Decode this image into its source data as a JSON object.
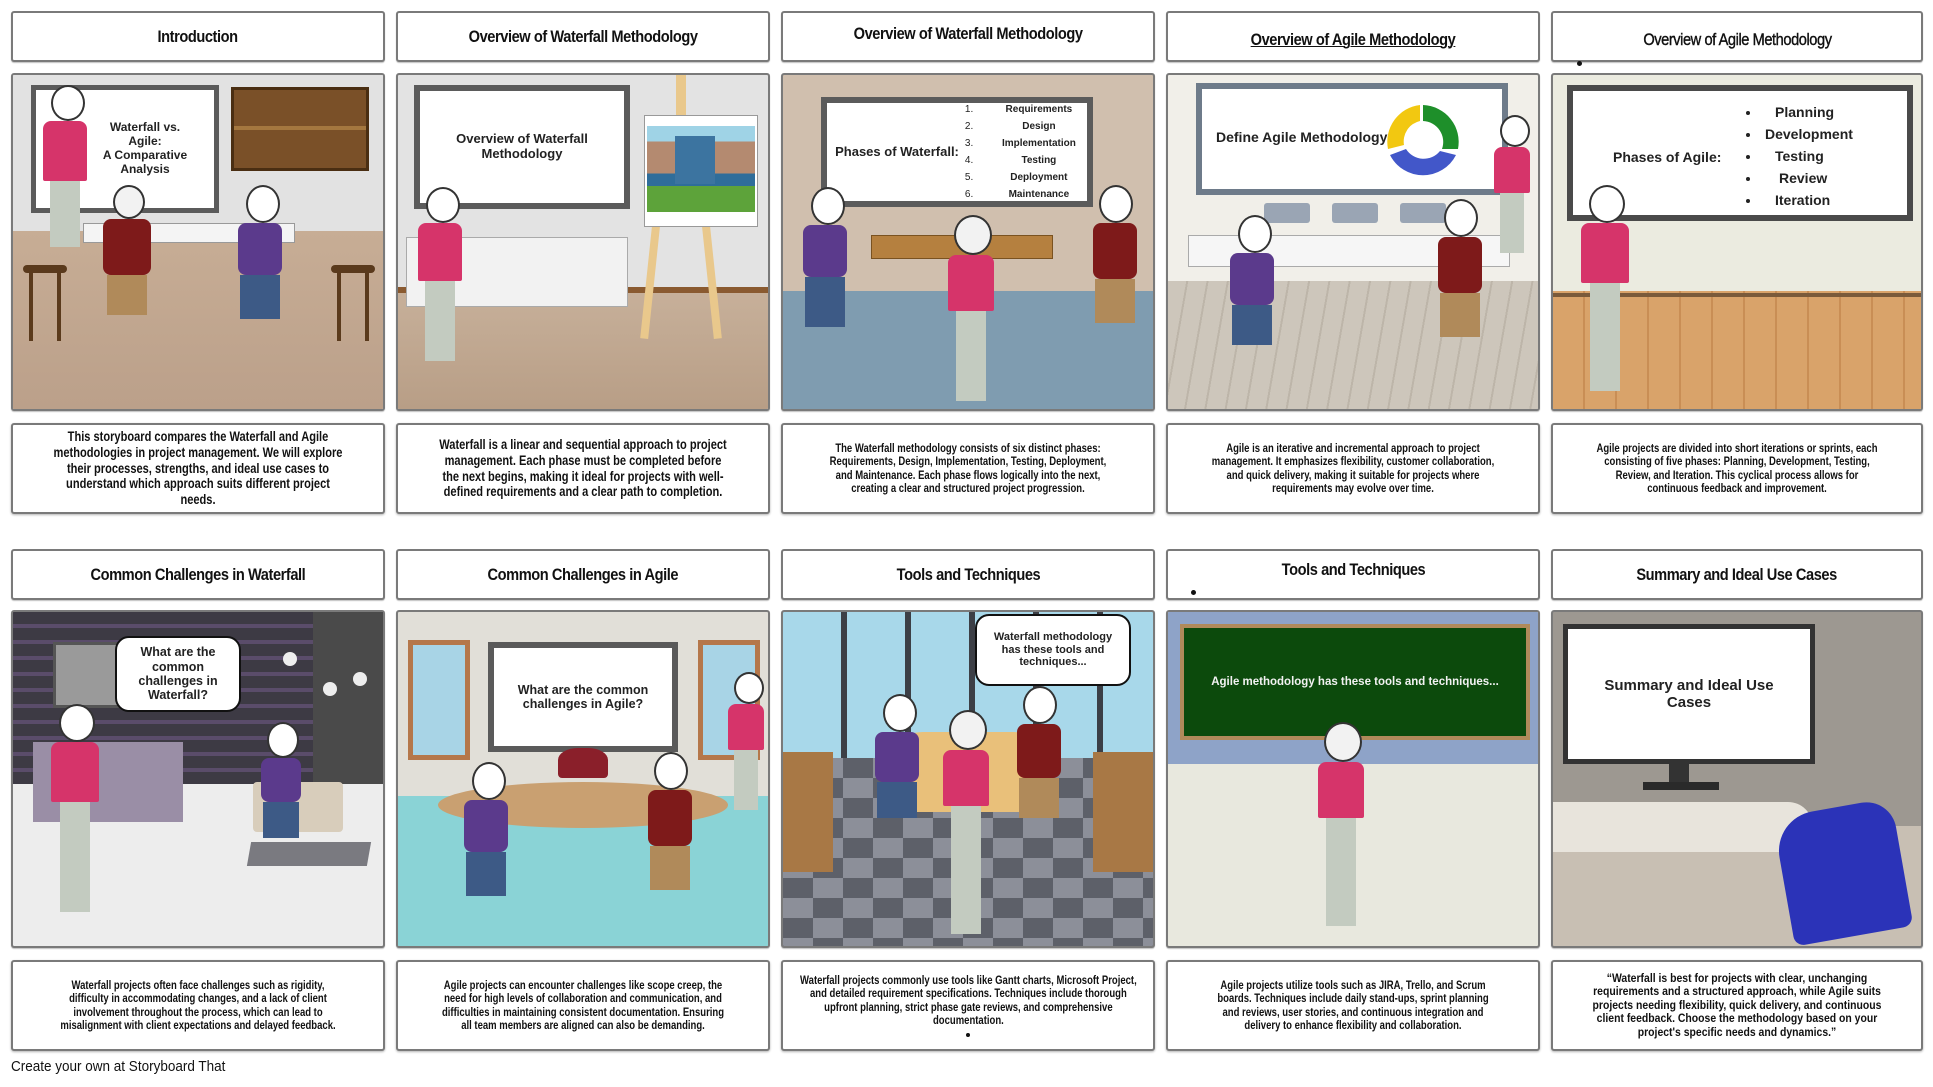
{
  "storyboard": {
    "row1": [
      {
        "title": "Introduction",
        "scene_text": [
          "Waterfall vs.",
          "Agile:",
          "A Comparative",
          "Analysis"
        ],
        "description": "This storyboard compares the Waterfall and Agile methodologies in project management. We will explore their processes, strengths, and ideal use cases to understand which approach suits different project needs."
      },
      {
        "title": "Overview of Waterfall Methodology",
        "scene_text": [
          "Overview of Waterfall",
          "Methodology"
        ],
        "description": "Waterfall is a linear and sequential approach to project management. Each phase must be completed before the next begins, making it ideal for projects with well-defined requirements and a clear path to completion."
      },
      {
        "title": "Overview of Waterfall Methodology",
        "board_label": "Phases of Waterfall:",
        "phases": [
          {
            "num": "1.",
            "name": "Requirements"
          },
          {
            "num": "2.",
            "name": "Design"
          },
          {
            "num": "3.",
            "name": "Implementation"
          },
          {
            "num": "4.",
            "name": "Testing"
          },
          {
            "num": "5.",
            "name": "Deployment"
          },
          {
            "num": "6.",
            "name": "Maintenance"
          }
        ],
        "description": "The Waterfall methodology consists of six distinct phases: Requirements, Design, Implementation, Testing, Deployment, and Maintenance. Each phase flows logically into the next, creating a clear and structured project progression."
      },
      {
        "title": "Overview of Agile Methodology",
        "board_label": "Define Agile Methodology",
        "description": "Agile is an iterative and incremental approach to project management. It emphasizes flexibility, customer collaboration, and quick delivery, making it suitable for projects where requirements may evolve over time."
      },
      {
        "title": "Overview of Agile Methodology",
        "board_label": "Phases of Agile:",
        "phases": [
          "Planning",
          "Development",
          "Testing",
          "Review",
          "Iteration"
        ],
        "description": "Agile projects are divided into short iterations or sprints, each consisting of five phases: Planning, Development, Testing, Review, and Iteration. This cyclical process allows for continuous feedback and improvement."
      }
    ],
    "row2": [
      {
        "title": "Common Challenges in Waterfall",
        "speech": "What are the common challenges in Waterfall?",
        "description": "Waterfall projects often face challenges such as rigidity, difficulty in accommodating changes, and a lack of client involvement throughout the process, which can lead to misalignment with client expectations and delayed feedback."
      },
      {
        "title": "Common Challenges in Agile",
        "board_label": "What are the common challenges in Agile?",
        "description": "Agile projects can encounter challenges like scope creep, the need for high levels of collaboration and communication, and difficulties in maintaining consistent documentation. Ensuring all team members are aligned can also be demanding."
      },
      {
        "title": "Tools and Techniques",
        "speech": "Waterfall methodology has these tools and techniques...",
        "description": "Waterfall projects commonly use tools like Gantt charts, Microsoft Project, and detailed requirement specifications. Techniques include thorough upfront planning, strict phase gate reviews, and comprehensive documentation."
      },
      {
        "title": "Tools and Techniques",
        "board_label": "Agile methodology has these tools and techniques...",
        "description": "Agile projects utilize tools such as JIRA, Trello, and Scrum boards. Techniques include daily stand-ups, sprint planning and reviews, user stories, and continuous integration and delivery to enhance flexibility and collaboration."
      },
      {
        "title": "Summary and Ideal Use Cases",
        "board_label": "Summary and Ideal Use Cases",
        "description": "“Waterfall is best for projects with clear, unchanging requirements and a structured approach, while Agile suits projects needing flexibility, quick delivery, and continuous client feedback. Choose the methodology based on your project's specific needs and dynamics.”"
      }
    ]
  },
  "footer": "Create your own at Storyboard That",
  "colors": {
    "border": "#7a7a7a",
    "agile_cycle": [
      "#f2c811",
      "#1e8f2a",
      "#4257c9"
    ],
    "chalkboard": "#0c4a0c",
    "jacket_pink": "#d6346a",
    "shirt_maroon": "#7e1a1a",
    "cardigan_purple": "#5b3a8c"
  }
}
